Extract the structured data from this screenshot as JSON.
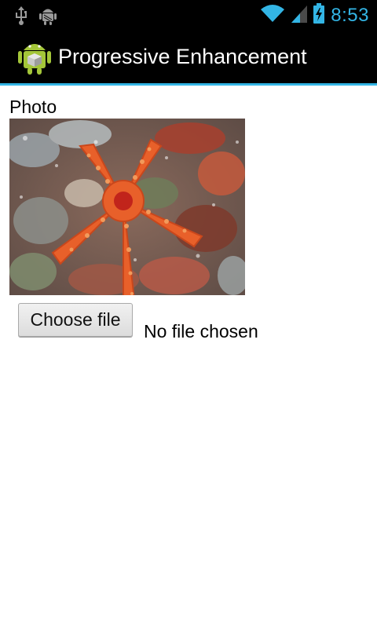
{
  "status_bar": {
    "time": "8:53",
    "icons": [
      "usb-icon",
      "android-debug-icon",
      "wifi-icon",
      "signal-icon",
      "battery-charging-icon"
    ]
  },
  "action_bar": {
    "app_icon": "android-app-icon",
    "title": "Progressive Enhancement"
  },
  "form": {
    "photo_label": "Photo",
    "photo_subject": "orange starfish on coral reef",
    "choose_file_label": "Choose file",
    "file_status": "No file chosen"
  },
  "colors": {
    "accent": "#33b5e5",
    "bar_background": "#000000",
    "page_background": "#ffffff"
  }
}
